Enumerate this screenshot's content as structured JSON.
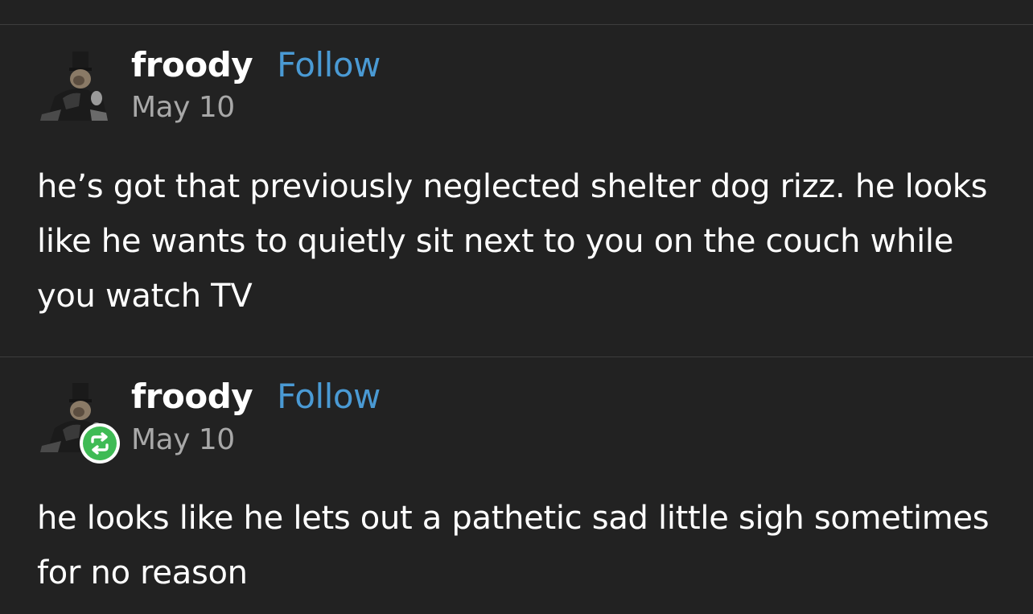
{
  "posts": [
    {
      "username": "froody",
      "follow_label": "Follow",
      "date": "May 10",
      "text": "he’s got that previously neglected shelter dog rizz. he looks like he wants to quietly sit next to you on the couch while you watch TV",
      "avatar_icon": "avatar-icon",
      "reblogged": false
    },
    {
      "username": "froody",
      "follow_label": "Follow",
      "date": "May 10",
      "text": "he looks like he lets out a pathetic sad little sigh sometimes for no reason",
      "avatar_icon": "avatar-icon",
      "reblogged": true,
      "badge_icon": "reblog-icon"
    }
  ],
  "colors": {
    "background": "#222222",
    "divider": "#3d3d3d",
    "follow_link": "#4a9ad4",
    "date_text": "#a8a8a8",
    "reblog_badge": "#3fbb55"
  }
}
